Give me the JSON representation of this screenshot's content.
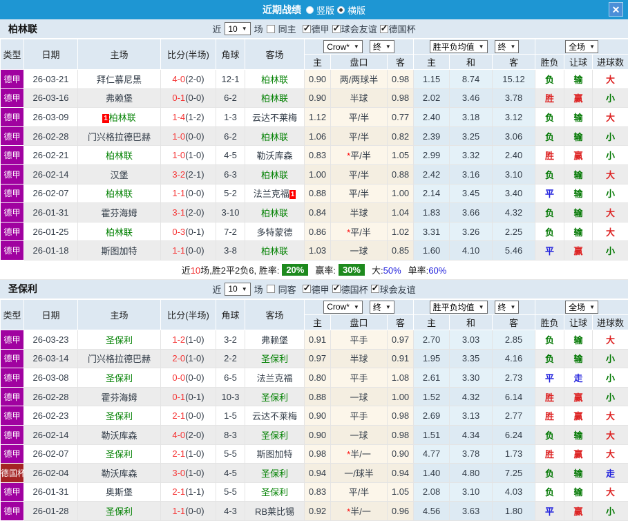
{
  "palette": {
    "topbar": "#1e96d3",
    "league_badge": "#a002a0",
    "cup_badge": "#a42424",
    "focal_team": "#008000",
    "score": "#f53535",
    "win": "#dd2222",
    "lose": "#007700",
    "draw": "#2222dd"
  },
  "titlebar": {
    "title": "近期战绩",
    "radios": [
      {
        "label": "竖版",
        "selected": false
      },
      {
        "label": "横版",
        "selected": true
      }
    ],
    "close": "✕"
  },
  "columns": [
    "类型",
    "日期",
    "主场",
    "比分(半场)",
    "角球",
    "客场",
    "主",
    "盘口",
    "客",
    "主",
    "和",
    "客",
    "胜负",
    "让球",
    "进球数"
  ],
  "sections": [
    {
      "team": "柏林联",
      "filter": {
        "near": "近",
        "count": "10",
        "games": "场",
        "same_label": "同主",
        "same_checked": false,
        "leagues": [
          {
            "label": "德甲",
            "checked": true
          },
          {
            "label": "球会友谊",
            "checked": true
          },
          {
            "label": "德国杯",
            "checked": true
          }
        ]
      },
      "dropdowns": {
        "book": "Crow*",
        "final1": "终",
        "avg": "胜平负均值",
        "final2": "终",
        "scope": "全场"
      },
      "rows": [
        {
          "lg": "德甲",
          "cup": false,
          "date": "26-03-21",
          "home": "拜仁慕尼黑",
          "hf": false,
          "hcard": null,
          "score": "4-0",
          "half": "(2-0)",
          "corner": "12-1",
          "away": "柏林联",
          "af": true,
          "acard": null,
          "o1": "0.90",
          "hcp": "两/两球半",
          "star": false,
          "o2": "0.98",
          "a1": "1.15",
          "a2": "8.74",
          "a3": "15.12",
          "res": [
            "负",
            "green"
          ],
          "let": [
            "输",
            "green"
          ],
          "goal": [
            "大",
            "red"
          ]
        },
        {
          "lg": "德甲",
          "cup": false,
          "date": "26-03-16",
          "home": "弗赖堡",
          "hf": false,
          "hcard": null,
          "score": "0-1",
          "half": "(0-0)",
          "corner": "6-2",
          "away": "柏林联",
          "af": true,
          "acard": null,
          "o1": "0.90",
          "hcp": "半球",
          "star": false,
          "o2": "0.98",
          "a1": "2.02",
          "a2": "3.46",
          "a3": "3.78",
          "res": [
            "胜",
            "red"
          ],
          "let": [
            "赢",
            "red"
          ],
          "goal": [
            "小",
            "green"
          ]
        },
        {
          "lg": "德甲",
          "cup": false,
          "date": "26-03-09",
          "home": "柏林联",
          "hf": true,
          "hcard": "1",
          "score": "1-4",
          "half": "(1-2)",
          "corner": "1-3",
          "away": "云达不莱梅",
          "af": false,
          "acard": null,
          "o1": "1.12",
          "hcp": "平/半",
          "star": false,
          "o2": "0.77",
          "a1": "2.40",
          "a2": "3.18",
          "a3": "3.12",
          "res": [
            "负",
            "green"
          ],
          "let": [
            "输",
            "green"
          ],
          "goal": [
            "大",
            "red"
          ]
        },
        {
          "lg": "德甲",
          "cup": false,
          "date": "26-02-28",
          "home": "门兴格拉德巴赫",
          "hf": false,
          "hcard": null,
          "score": "1-0",
          "half": "(0-0)",
          "corner": "6-2",
          "away": "柏林联",
          "af": true,
          "acard": null,
          "o1": "1.06",
          "hcp": "平/半",
          "star": false,
          "o2": "0.82",
          "a1": "2.39",
          "a2": "3.25",
          "a3": "3.06",
          "res": [
            "负",
            "green"
          ],
          "let": [
            "输",
            "green"
          ],
          "goal": [
            "小",
            "green"
          ]
        },
        {
          "lg": "德甲",
          "cup": false,
          "date": "26-02-21",
          "home": "柏林联",
          "hf": true,
          "hcard": null,
          "score": "1-0",
          "half": "(1-0)",
          "corner": "4-5",
          "away": "勒沃库森",
          "af": false,
          "acard": null,
          "o1": "0.83",
          "hcp": "平/半",
          "star": true,
          "o2": "1.05",
          "a1": "2.99",
          "a2": "3.32",
          "a3": "2.40",
          "res": [
            "胜",
            "red"
          ],
          "let": [
            "赢",
            "red"
          ],
          "goal": [
            "小",
            "green"
          ]
        },
        {
          "lg": "德甲",
          "cup": false,
          "date": "26-02-14",
          "home": "汉堡",
          "hf": false,
          "hcard": null,
          "score": "3-2",
          "half": "(2-1)",
          "corner": "6-3",
          "away": "柏林联",
          "af": true,
          "acard": null,
          "o1": "1.00",
          "hcp": "平/半",
          "star": false,
          "o2": "0.88",
          "a1": "2.42",
          "a2": "3.16",
          "a3": "3.10",
          "res": [
            "负",
            "green"
          ],
          "let": [
            "输",
            "green"
          ],
          "goal": [
            "大",
            "red"
          ]
        },
        {
          "lg": "德甲",
          "cup": false,
          "date": "26-02-07",
          "home": "柏林联",
          "hf": true,
          "hcard": null,
          "score": "1-1",
          "half": "(0-0)",
          "corner": "5-2",
          "away": "法兰克福",
          "af": false,
          "acard": "1",
          "o1": "0.88",
          "hcp": "平/半",
          "star": false,
          "o2": "1.00",
          "a1": "2.14",
          "a2": "3.45",
          "a3": "3.40",
          "res": [
            "平",
            "blue"
          ],
          "let": [
            "输",
            "green"
          ],
          "goal": [
            "小",
            "green"
          ]
        },
        {
          "lg": "德甲",
          "cup": false,
          "date": "26-01-31",
          "home": "霍芬海姆",
          "hf": false,
          "hcard": null,
          "score": "3-1",
          "half": "(2-0)",
          "corner": "3-10",
          "away": "柏林联",
          "af": true,
          "acard": null,
          "o1": "0.84",
          "hcp": "半球",
          "star": false,
          "o2": "1.04",
          "a1": "1.83",
          "a2": "3.66",
          "a3": "4.32",
          "res": [
            "负",
            "green"
          ],
          "let": [
            "输",
            "green"
          ],
          "goal": [
            "大",
            "red"
          ]
        },
        {
          "lg": "德甲",
          "cup": false,
          "date": "26-01-25",
          "home": "柏林联",
          "hf": true,
          "hcard": null,
          "score": "0-3",
          "half": "(0-1)",
          "corner": "7-2",
          "away": "多特蒙德",
          "af": false,
          "acard": null,
          "o1": "0.86",
          "hcp": "平/半",
          "star": true,
          "o2": "1.02",
          "a1": "3.31",
          "a2": "3.26",
          "a3": "2.25",
          "res": [
            "负",
            "green"
          ],
          "let": [
            "输",
            "green"
          ],
          "goal": [
            "大",
            "red"
          ]
        },
        {
          "lg": "德甲",
          "cup": false,
          "date": "26-01-18",
          "home": "斯图加特",
          "hf": false,
          "hcard": null,
          "score": "1-1",
          "half": "(0-0)",
          "corner": "3-8",
          "away": "柏林联",
          "af": true,
          "acard": null,
          "o1": "1.03",
          "hcp": "一球",
          "star": false,
          "o2": "0.85",
          "a1": "1.60",
          "a2": "4.10",
          "a3": "5.46",
          "res": [
            "平",
            "blue"
          ],
          "let": [
            "赢",
            "red"
          ],
          "goal": [
            "小",
            "green"
          ]
        }
      ],
      "summary": {
        "near": "近",
        "count": "10",
        "text": "场,胜2平2负6, 胜率:",
        "win_rate": "20%",
        "label2": "赢率:",
        "handicap_rate": "30%",
        "label3": "大:",
        "big_rate": "50%",
        "label4": "单率:",
        "single_rate": "60%"
      }
    },
    {
      "team": "圣保利",
      "filter": {
        "near": "近",
        "count": "10",
        "games": "场",
        "same_label": "同客",
        "same_checked": false,
        "leagues": [
          {
            "label": "德甲",
            "checked": true
          },
          {
            "label": "德国杯",
            "checked": true
          },
          {
            "label": "球会友谊",
            "checked": true
          }
        ]
      },
      "dropdowns": {
        "book": "Crow*",
        "final1": "终",
        "avg": "胜平负均值",
        "final2": "终",
        "scope": "全场"
      },
      "rows": [
        {
          "lg": "德甲",
          "cup": false,
          "date": "26-03-23",
          "home": "圣保利",
          "hf": true,
          "hcard": null,
          "score": "1-2",
          "half": "(1-0)",
          "corner": "3-2",
          "away": "弗赖堡",
          "af": false,
          "acard": null,
          "o1": "0.91",
          "hcp": "平手",
          "star": false,
          "o2": "0.97",
          "a1": "2.70",
          "a2": "3.03",
          "a3": "2.85",
          "res": [
            "负",
            "green"
          ],
          "let": [
            "输",
            "green"
          ],
          "goal": [
            "大",
            "red"
          ]
        },
        {
          "lg": "德甲",
          "cup": false,
          "date": "26-03-14",
          "home": "门兴格拉德巴赫",
          "hf": false,
          "hcard": null,
          "score": "2-0",
          "half": "(1-0)",
          "corner": "2-2",
          "away": "圣保利",
          "af": true,
          "acard": null,
          "o1": "0.97",
          "hcp": "半球",
          "star": false,
          "o2": "0.91",
          "a1": "1.95",
          "a2": "3.35",
          "a3": "4.16",
          "res": [
            "负",
            "green"
          ],
          "let": [
            "输",
            "green"
          ],
          "goal": [
            "小",
            "green"
          ]
        },
        {
          "lg": "德甲",
          "cup": false,
          "date": "26-03-08",
          "home": "圣保利",
          "hf": true,
          "hcard": null,
          "score": "0-0",
          "half": "(0-0)",
          "corner": "6-5",
          "away": "法兰克福",
          "af": false,
          "acard": null,
          "o1": "0.80",
          "hcp": "平手",
          "star": false,
          "o2": "1.08",
          "a1": "2.61",
          "a2": "3.30",
          "a3": "2.73",
          "res": [
            "平",
            "blue"
          ],
          "let": [
            "走",
            "blue"
          ],
          "goal": [
            "小",
            "green"
          ]
        },
        {
          "lg": "德甲",
          "cup": false,
          "date": "26-02-28",
          "home": "霍芬海姆",
          "hf": false,
          "hcard": null,
          "score": "0-1",
          "half": "(0-1)",
          "corner": "10-3",
          "away": "圣保利",
          "af": true,
          "acard": null,
          "o1": "0.88",
          "hcp": "一球",
          "star": false,
          "o2": "1.00",
          "a1": "1.52",
          "a2": "4.32",
          "a3": "6.14",
          "res": [
            "胜",
            "red"
          ],
          "let": [
            "赢",
            "red"
          ],
          "goal": [
            "小",
            "green"
          ]
        },
        {
          "lg": "德甲",
          "cup": false,
          "date": "26-02-23",
          "home": "圣保利",
          "hf": true,
          "hcard": null,
          "score": "2-1",
          "half": "(0-0)",
          "corner": "1-5",
          "away": "云达不莱梅",
          "af": false,
          "acard": null,
          "o1": "0.90",
          "hcp": "平手",
          "star": false,
          "o2": "0.98",
          "a1": "2.69",
          "a2": "3.13",
          "a3": "2.77",
          "res": [
            "胜",
            "red"
          ],
          "let": [
            "赢",
            "red"
          ],
          "goal": [
            "大",
            "red"
          ]
        },
        {
          "lg": "德甲",
          "cup": false,
          "date": "26-02-14",
          "home": "勒沃库森",
          "hf": false,
          "hcard": null,
          "score": "4-0",
          "half": "(2-0)",
          "corner": "8-3",
          "away": "圣保利",
          "af": true,
          "acard": null,
          "o1": "0.90",
          "hcp": "一球",
          "star": false,
          "o2": "0.98",
          "a1": "1.51",
          "a2": "4.34",
          "a3": "6.24",
          "res": [
            "负",
            "green"
          ],
          "let": [
            "输",
            "green"
          ],
          "goal": [
            "大",
            "red"
          ]
        },
        {
          "lg": "德甲",
          "cup": false,
          "date": "26-02-07",
          "home": "圣保利",
          "hf": true,
          "hcard": null,
          "score": "2-1",
          "half": "(1-0)",
          "corner": "5-5",
          "away": "斯图加特",
          "af": false,
          "acard": null,
          "o1": "0.98",
          "hcp": "半/一",
          "star": true,
          "o2": "0.90",
          "a1": "4.77",
          "a2": "3.78",
          "a3": "1.73",
          "res": [
            "胜",
            "red"
          ],
          "let": [
            "赢",
            "red"
          ],
          "goal": [
            "大",
            "red"
          ]
        },
        {
          "lg": "德国杯",
          "cup": true,
          "date": "26-02-04",
          "home": "勒沃库森",
          "hf": false,
          "hcard": null,
          "score": "3-0",
          "half": "(1-0)",
          "corner": "4-5",
          "away": "圣保利",
          "af": true,
          "acard": null,
          "o1": "0.94",
          "hcp": "一/球半",
          "star": false,
          "o2": "0.94",
          "a1": "1.40",
          "a2": "4.80",
          "a3": "7.25",
          "res": [
            "负",
            "green"
          ],
          "let": [
            "输",
            "green"
          ],
          "goal": [
            "走",
            "blue"
          ]
        },
        {
          "lg": "德甲",
          "cup": false,
          "date": "26-01-31",
          "home": "奥斯堡",
          "hf": false,
          "hcard": null,
          "score": "2-1",
          "half": "(1-1)",
          "corner": "5-5",
          "away": "圣保利",
          "af": true,
          "acard": null,
          "o1": "0.83",
          "hcp": "平/半",
          "star": false,
          "o2": "1.05",
          "a1": "2.08",
          "a2": "3.10",
          "a3": "4.03",
          "res": [
            "负",
            "green"
          ],
          "let": [
            "输",
            "green"
          ],
          "goal": [
            "大",
            "red"
          ]
        },
        {
          "lg": "德甲",
          "cup": false,
          "date": "26-01-28",
          "home": "圣保利",
          "hf": true,
          "hcard": null,
          "score": "1-1",
          "half": "(0-0)",
          "corner": "4-3",
          "away": "RB莱比锡",
          "af": false,
          "acard": null,
          "o1": "0.92",
          "hcp": "半/一",
          "star": true,
          "o2": "0.96",
          "a1": "4.56",
          "a2": "3.63",
          "a3": "1.80",
          "res": [
            "平",
            "blue"
          ],
          "let": [
            "赢",
            "red"
          ],
          "goal": [
            "小",
            "green"
          ]
        }
      ],
      "summary": null
    }
  ]
}
